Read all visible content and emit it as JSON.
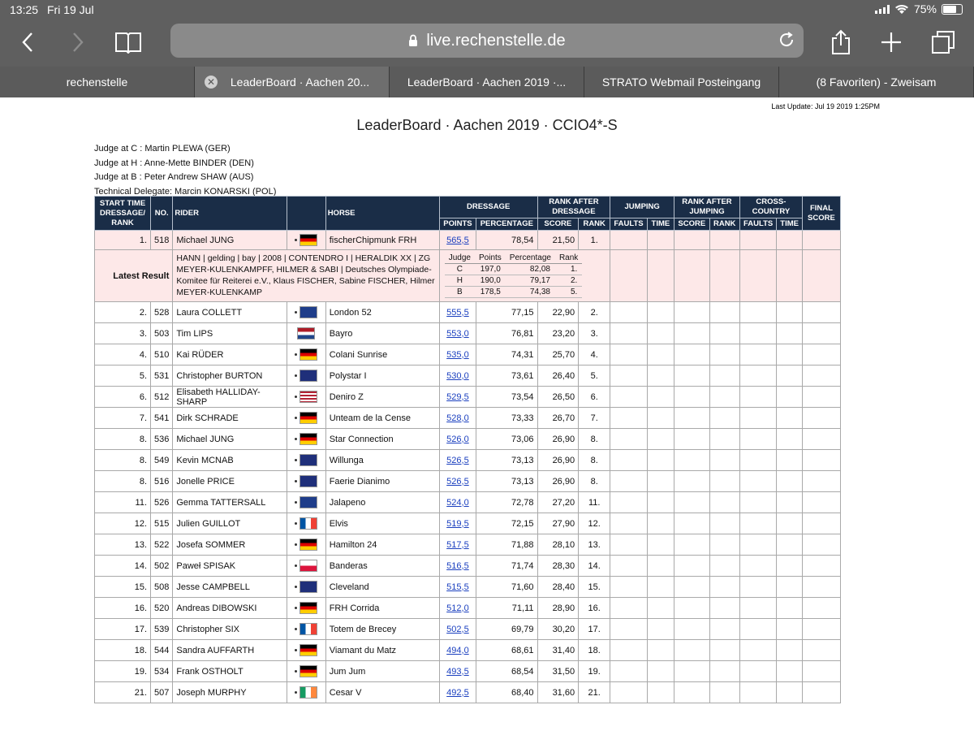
{
  "status_bar": {
    "time": "13:25",
    "date": "Fri 19 Jul",
    "battery": "75%"
  },
  "browser": {
    "url": "live.rechenstelle.de"
  },
  "tabs": [
    {
      "label": "rechenstelle",
      "active": false,
      "closable": false
    },
    {
      "label": "LeaderBoard · Aachen 20...",
      "active": true,
      "closable": true
    },
    {
      "label": "LeaderBoard · Aachen 2019 ·...",
      "active": false,
      "closable": false
    },
    {
      "label": "STRATO Webmail Posteingang",
      "active": false,
      "closable": false
    },
    {
      "label": "(8 Favoriten) - Zweisam",
      "active": false,
      "closable": false
    }
  ],
  "page": {
    "last_update": "Last Update: Jul 19 2019 1:25PM",
    "title": "LeaderBoard · Aachen 2019 · CCIO4*-S",
    "judges": [
      "Judge at C : Martin PLEWA (GER)",
      "Judge at H : Anne-Mette BINDER (DEN)",
      "Judge at B : Peter Andrew SHAW (AUS)",
      "Technical Delegate: Marcin KONARSKI (POL)"
    ]
  },
  "table": {
    "headers": {
      "start": "START TIME DRESSAGE/ RANK",
      "no": "NO.",
      "rider": "RIDER",
      "horse": "HORSE",
      "dressage": "DRESSAGE",
      "rank_after_dressage": "RANK AFTER DRESSAGE",
      "jumping": "JUMPING",
      "rank_after_jumping": "RANK AFTER JUMPING",
      "cross_country": "CROSS-COUNTRY",
      "final_score": "FINAL SCORE",
      "points": "POINTS",
      "percentage": "PERCENTAGE",
      "score": "SCORE",
      "rank": "RANK",
      "faults": "FAULTS",
      "time": "TIME"
    },
    "detail": {
      "label": "Latest Result",
      "text": "HANN | gelding | bay | 2008 | CONTENDRO I | HERALDIK XX | ZG MEYER-KULENKAMPFF, HILMER & SABI | Deutsches Olympiade-Komitee für Reiterei e.V., Klaus FISCHER, Sabine FISCHER, Hilmer MEYER-KULENKAMP",
      "sub_headers": [
        "Judge",
        "Points",
        "Percentage",
        "Rank"
      ],
      "sub_rows": [
        [
          "C",
          "197,0",
          "82,08",
          "1."
        ],
        [
          "H",
          "190,0",
          "79,17",
          "2."
        ],
        [
          "B",
          "178,5",
          "74,38",
          "5."
        ]
      ]
    },
    "rows": [
      {
        "rank": "1.",
        "no": "518",
        "rider": "Michael JUNG",
        "flag": "ger",
        "horse": "fischerChipmunk FRH",
        "points": "565,5",
        "pct": "78,54",
        "score": "21,50",
        "drank": "1."
      },
      {
        "rank": "2.",
        "no": "528",
        "rider": "Laura COLLETT",
        "flag": "gbr",
        "horse": "London 52",
        "points": "555,5",
        "pct": "77,15",
        "score": "22,90",
        "drank": "2."
      },
      {
        "rank": "3.",
        "no": "503",
        "rider": "Tim LIPS",
        "flag": "ned",
        "horse": "Bayro",
        "points": "553,0",
        "pct": "76,81",
        "score": "23,20",
        "drank": "3."
      },
      {
        "rank": "4.",
        "no": "510",
        "rider": "Kai RÜDER",
        "flag": "ger",
        "horse": "Colani Sunrise",
        "points": "535,0",
        "pct": "74,31",
        "score": "25,70",
        "drank": "4."
      },
      {
        "rank": "5.",
        "no": "531",
        "rider": "Christopher BURTON",
        "flag": "aus",
        "horse": "Polystar I",
        "points": "530,0",
        "pct": "73,61",
        "score": "26,40",
        "drank": "5."
      },
      {
        "rank": "6.",
        "no": "512",
        "rider": "Elisabeth HALLIDAY-SHARP",
        "flag": "usa",
        "horse": "Deniro Z",
        "points": "529,5",
        "pct": "73,54",
        "score": "26,50",
        "drank": "6."
      },
      {
        "rank": "7.",
        "no": "541",
        "rider": "Dirk SCHRADE",
        "flag": "ger",
        "horse": "Unteam de la Cense",
        "points": "528,0",
        "pct": "73,33",
        "score": "26,70",
        "drank": "7."
      },
      {
        "rank": "8.",
        "no": "536",
        "rider": "Michael JUNG",
        "flag": "ger",
        "horse": "Star Connection",
        "points": "526,0",
        "pct": "73,06",
        "score": "26,90",
        "drank": "8."
      },
      {
        "rank": "8.",
        "no": "549",
        "rider": "Kevin MCNAB",
        "flag": "aus",
        "horse": "Willunga",
        "points": "526,5",
        "pct": "73,13",
        "score": "26,90",
        "drank": "8."
      },
      {
        "rank": "8.",
        "no": "516",
        "rider": "Jonelle PRICE",
        "flag": "nzl",
        "horse": "Faerie Dianimo",
        "points": "526,5",
        "pct": "73,13",
        "score": "26,90",
        "drank": "8."
      },
      {
        "rank": "11.",
        "no": "526",
        "rider": "Gemma TATTERSALL",
        "flag": "gbr",
        "horse": "Jalapeno",
        "points": "524,0",
        "pct": "72,78",
        "score": "27,20",
        "drank": "11."
      },
      {
        "rank": "12.",
        "no": "515",
        "rider": "Julien GUILLOT",
        "flag": "fra",
        "horse": "Elvis",
        "points": "519,5",
        "pct": "72,15",
        "score": "27,90",
        "drank": "12."
      },
      {
        "rank": "13.",
        "no": "522",
        "rider": "Josefa SOMMER",
        "flag": "ger",
        "horse": "Hamilton 24",
        "points": "517,5",
        "pct": "71,88",
        "score": "28,10",
        "drank": "13."
      },
      {
        "rank": "14.",
        "no": "502",
        "rider": "Paweł SPISAK",
        "flag": "pol",
        "horse": "Banderas",
        "points": "516,5",
        "pct": "71,74",
        "score": "28,30",
        "drank": "14."
      },
      {
        "rank": "15.",
        "no": "508",
        "rider": "Jesse CAMPBELL",
        "flag": "nzl",
        "horse": "Cleveland",
        "points": "515,5",
        "pct": "71,60",
        "score": "28,40",
        "drank": "15."
      },
      {
        "rank": "16.",
        "no": "520",
        "rider": "Andreas DIBOWSKI",
        "flag": "ger",
        "horse": "FRH Corrida",
        "points": "512,0",
        "pct": "71,11",
        "score": "28,90",
        "drank": "16."
      },
      {
        "rank": "17.",
        "no": "539",
        "rider": "Christopher SIX",
        "flag": "fra",
        "horse": "Totem de Brecey",
        "points": "502,5",
        "pct": "69,79",
        "score": "30,20",
        "drank": "17."
      },
      {
        "rank": "18.",
        "no": "544",
        "rider": "Sandra AUFFARTH",
        "flag": "ger",
        "horse": "Viamant du Matz",
        "points": "494,0",
        "pct": "68,61",
        "score": "31,40",
        "drank": "18."
      },
      {
        "rank": "19.",
        "no": "534",
        "rider": "Frank OSTHOLT",
        "flag": "ger",
        "horse": "Jum Jum",
        "points": "493,5",
        "pct": "68,54",
        "score": "31,50",
        "drank": "19."
      },
      {
        "rank": "21.",
        "no": "507",
        "rider": "Joseph MURPHY",
        "flag": "irl",
        "horse": "Cesar V",
        "points": "492,5",
        "pct": "68,40",
        "score": "31,60",
        "drank": "21."
      }
    ]
  }
}
